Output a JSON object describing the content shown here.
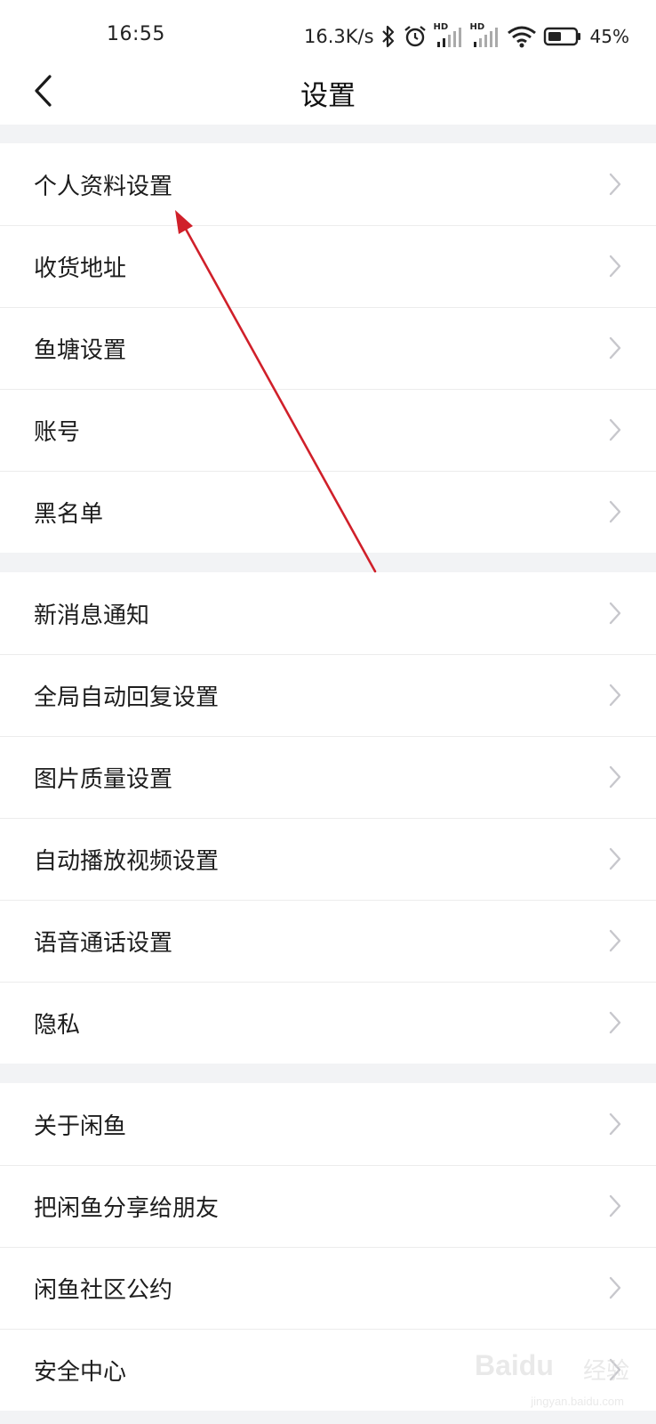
{
  "status_bar": {
    "time": "16:55",
    "net_speed": "16.3K/s",
    "signal_1_label": "HD",
    "signal_2_label": "HD",
    "battery_percent": "45%"
  },
  "header": {
    "title": "设置",
    "back_icon": "chevron-left-icon"
  },
  "sections": [
    {
      "items": [
        "个人资料设置",
        "收货地址",
        "鱼塘设置",
        "账号",
        "黑名单"
      ]
    },
    {
      "items": [
        "新消息通知",
        "全局自动回复设置",
        "图片质量设置",
        "自动播放视频设置",
        "语音通话设置",
        "隐私"
      ]
    },
    {
      "items": [
        "关于闲鱼",
        "把闲鱼分享给朋友",
        "闲鱼社区公约",
        "安全中心"
      ]
    }
  ],
  "colors": {
    "annotation_arrow": "#d0202a",
    "page_background": "#f2f3f5",
    "row_background": "#ffffff",
    "chevron": "#c7c7cc"
  },
  "watermark": {
    "brand": "Baidu",
    "label": "经验",
    "url": "jingyan.baidu.com"
  }
}
